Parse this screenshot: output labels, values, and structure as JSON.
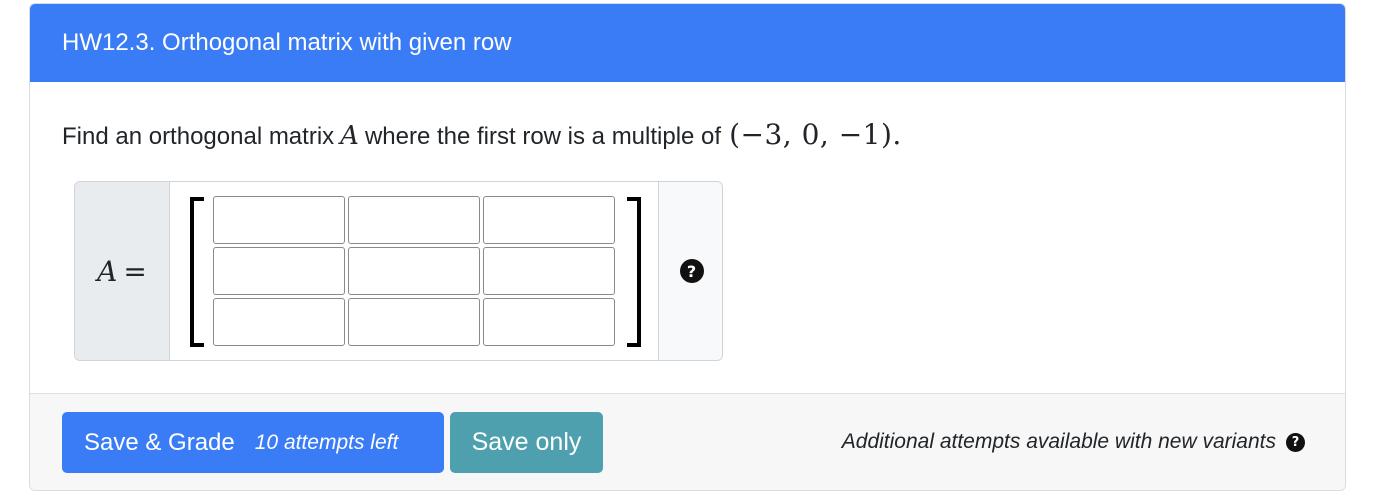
{
  "header": {
    "title": "HW12.3. Orthogonal matrix with given row"
  },
  "question": {
    "text_before": "Find an orthogonal matrix",
    "variable": "A",
    "text_after": "where the first row is a multiple of",
    "vector": "(−3, 0, −1)."
  },
  "answer": {
    "label_var": "A",
    "label_eq": "=",
    "rows": 3,
    "cols": 3,
    "cells": [
      [
        "",
        "",
        ""
      ],
      [
        "",
        "",
        ""
      ],
      [
        "",
        "",
        ""
      ]
    ],
    "help_icon": "question-circle-icon",
    "help_glyph": "?"
  },
  "footer": {
    "grade_label": "Save & Grade",
    "attempts_left": "10 attempts left",
    "save_label": "Save only",
    "note": "Additional attempts available with new variants",
    "note_icon_glyph": "?"
  },
  "colors": {
    "primary": "#3a7cf6",
    "secondary": "#4ea0ae",
    "footer_bg": "#f7f7f7"
  }
}
